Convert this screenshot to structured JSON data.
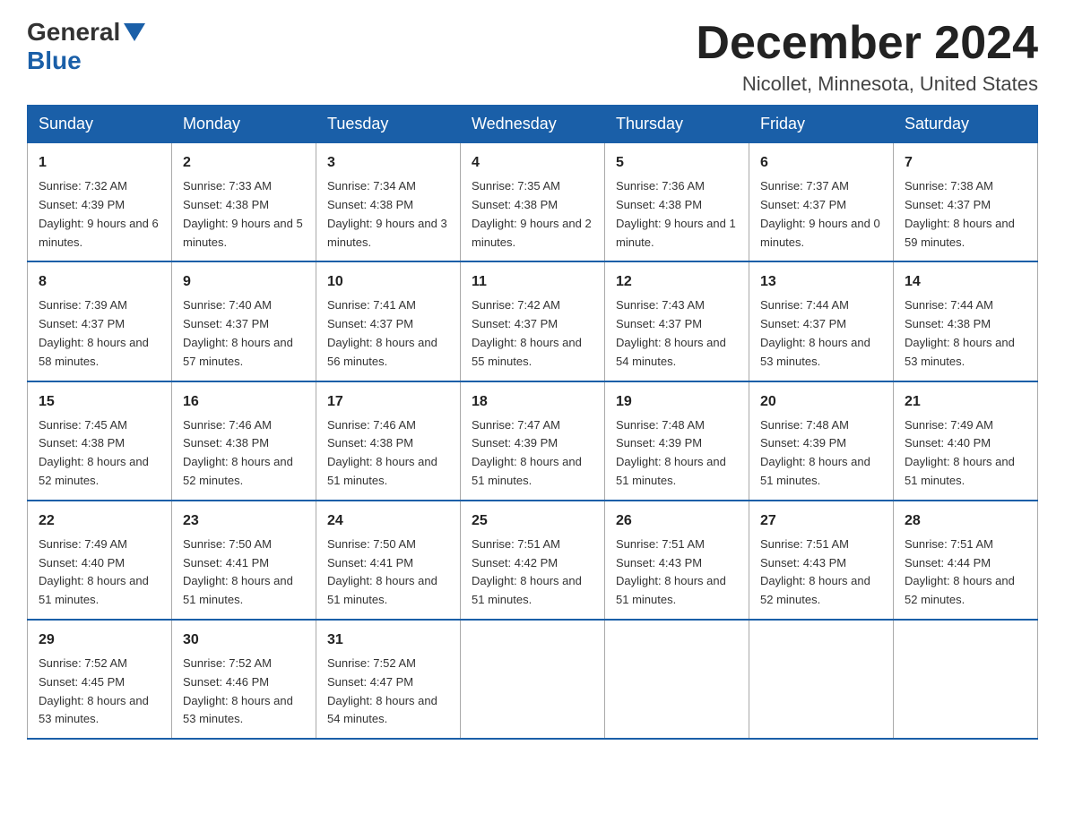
{
  "header": {
    "logo_general": "General",
    "logo_blue": "Blue",
    "month_title": "December 2024",
    "location": "Nicollet, Minnesota, United States"
  },
  "weekdays": [
    "Sunday",
    "Monday",
    "Tuesday",
    "Wednesday",
    "Thursday",
    "Friday",
    "Saturday"
  ],
  "weeks": [
    [
      {
        "day": "1",
        "sunrise": "7:32 AM",
        "sunset": "4:39 PM",
        "daylight": "9 hours and 6 minutes."
      },
      {
        "day": "2",
        "sunrise": "7:33 AM",
        "sunset": "4:38 PM",
        "daylight": "9 hours and 5 minutes."
      },
      {
        "day": "3",
        "sunrise": "7:34 AM",
        "sunset": "4:38 PM",
        "daylight": "9 hours and 3 minutes."
      },
      {
        "day": "4",
        "sunrise": "7:35 AM",
        "sunset": "4:38 PM",
        "daylight": "9 hours and 2 minutes."
      },
      {
        "day": "5",
        "sunrise": "7:36 AM",
        "sunset": "4:38 PM",
        "daylight": "9 hours and 1 minute."
      },
      {
        "day": "6",
        "sunrise": "7:37 AM",
        "sunset": "4:37 PM",
        "daylight": "9 hours and 0 minutes."
      },
      {
        "day": "7",
        "sunrise": "7:38 AM",
        "sunset": "4:37 PM",
        "daylight": "8 hours and 59 minutes."
      }
    ],
    [
      {
        "day": "8",
        "sunrise": "7:39 AM",
        "sunset": "4:37 PM",
        "daylight": "8 hours and 58 minutes."
      },
      {
        "day": "9",
        "sunrise": "7:40 AM",
        "sunset": "4:37 PM",
        "daylight": "8 hours and 57 minutes."
      },
      {
        "day": "10",
        "sunrise": "7:41 AM",
        "sunset": "4:37 PM",
        "daylight": "8 hours and 56 minutes."
      },
      {
        "day": "11",
        "sunrise": "7:42 AM",
        "sunset": "4:37 PM",
        "daylight": "8 hours and 55 minutes."
      },
      {
        "day": "12",
        "sunrise": "7:43 AM",
        "sunset": "4:37 PM",
        "daylight": "8 hours and 54 minutes."
      },
      {
        "day": "13",
        "sunrise": "7:44 AM",
        "sunset": "4:37 PM",
        "daylight": "8 hours and 53 minutes."
      },
      {
        "day": "14",
        "sunrise": "7:44 AM",
        "sunset": "4:38 PM",
        "daylight": "8 hours and 53 minutes."
      }
    ],
    [
      {
        "day": "15",
        "sunrise": "7:45 AM",
        "sunset": "4:38 PM",
        "daylight": "8 hours and 52 minutes."
      },
      {
        "day": "16",
        "sunrise": "7:46 AM",
        "sunset": "4:38 PM",
        "daylight": "8 hours and 52 minutes."
      },
      {
        "day": "17",
        "sunrise": "7:46 AM",
        "sunset": "4:38 PM",
        "daylight": "8 hours and 51 minutes."
      },
      {
        "day": "18",
        "sunrise": "7:47 AM",
        "sunset": "4:39 PM",
        "daylight": "8 hours and 51 minutes."
      },
      {
        "day": "19",
        "sunrise": "7:48 AM",
        "sunset": "4:39 PM",
        "daylight": "8 hours and 51 minutes."
      },
      {
        "day": "20",
        "sunrise": "7:48 AM",
        "sunset": "4:39 PM",
        "daylight": "8 hours and 51 minutes."
      },
      {
        "day": "21",
        "sunrise": "7:49 AM",
        "sunset": "4:40 PM",
        "daylight": "8 hours and 51 minutes."
      }
    ],
    [
      {
        "day": "22",
        "sunrise": "7:49 AM",
        "sunset": "4:40 PM",
        "daylight": "8 hours and 51 minutes."
      },
      {
        "day": "23",
        "sunrise": "7:50 AM",
        "sunset": "4:41 PM",
        "daylight": "8 hours and 51 minutes."
      },
      {
        "day": "24",
        "sunrise": "7:50 AM",
        "sunset": "4:41 PM",
        "daylight": "8 hours and 51 minutes."
      },
      {
        "day": "25",
        "sunrise": "7:51 AM",
        "sunset": "4:42 PM",
        "daylight": "8 hours and 51 minutes."
      },
      {
        "day": "26",
        "sunrise": "7:51 AM",
        "sunset": "4:43 PM",
        "daylight": "8 hours and 51 minutes."
      },
      {
        "day": "27",
        "sunrise": "7:51 AM",
        "sunset": "4:43 PM",
        "daylight": "8 hours and 52 minutes."
      },
      {
        "day": "28",
        "sunrise": "7:51 AM",
        "sunset": "4:44 PM",
        "daylight": "8 hours and 52 minutes."
      }
    ],
    [
      {
        "day": "29",
        "sunrise": "7:52 AM",
        "sunset": "4:45 PM",
        "daylight": "8 hours and 53 minutes."
      },
      {
        "day": "30",
        "sunrise": "7:52 AM",
        "sunset": "4:46 PM",
        "daylight": "8 hours and 53 minutes."
      },
      {
        "day": "31",
        "sunrise": "7:52 AM",
        "sunset": "4:47 PM",
        "daylight": "8 hours and 54 minutes."
      },
      null,
      null,
      null,
      null
    ]
  ]
}
